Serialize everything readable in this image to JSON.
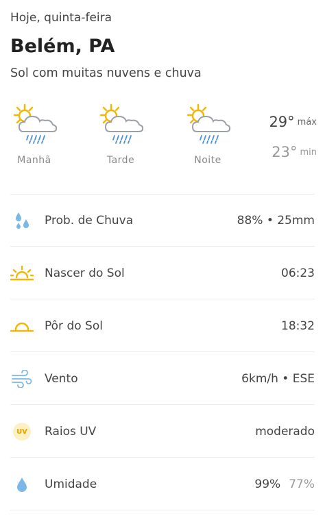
{
  "header": {
    "date": "Hoje, quinta-feira",
    "city": "Belém, PA",
    "condition": "Sol com muitas nuvens e chuva"
  },
  "periods": [
    {
      "label": "Manhã",
      "icon": "sun-cloud-rain-icon"
    },
    {
      "label": "Tarde",
      "icon": "sun-cloud-rain-icon"
    },
    {
      "label": "Noite",
      "icon": "sun-cloud-rain-icon"
    }
  ],
  "temps": {
    "max": "29°",
    "max_label": "máx",
    "min": "23°",
    "min_label": "min"
  },
  "details": [
    {
      "icon": "raindrops-icon",
      "label": "Prob. de Chuva",
      "value": "88% • 25mm"
    },
    {
      "icon": "sunrise-icon",
      "label": "Nascer do Sol",
      "value": "06:23"
    },
    {
      "icon": "sunset-icon",
      "label": "Pôr do Sol",
      "value": "18:32"
    },
    {
      "icon": "wind-icon",
      "label": "Vento",
      "value": "6km/h • ESE"
    },
    {
      "icon": "uv-icon",
      "label": "Raios UV",
      "value": "moderado",
      "badge": "UV"
    },
    {
      "icon": "humidity-drop-icon",
      "label": "Umidade",
      "value": "99%",
      "value2": "77%"
    }
  ],
  "colors": {
    "sun": "#f2b705",
    "cloud_stroke": "#9aa0a6",
    "rain": "#4a90e2",
    "drop": "#7ab8e8"
  }
}
